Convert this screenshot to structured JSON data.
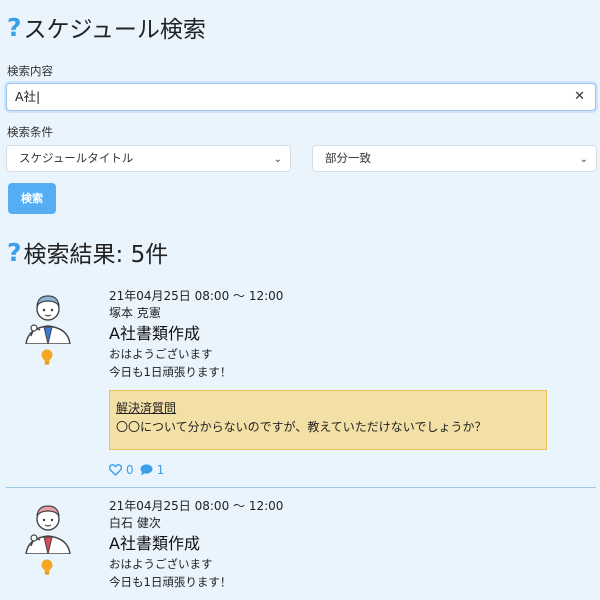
{
  "search_heading": "スケジュール検索",
  "form": {
    "content_label": "検索内容",
    "query_value": "A社|",
    "condition_label": "検索条件",
    "field_select": "スケジュールタイトル",
    "match_select": "部分一致",
    "search_button": "検索"
  },
  "results": {
    "heading": "検索結果: 5件",
    "items": [
      {
        "datetime": "21年04月25日 08:00 ～ 12:00",
        "author": "塚本 克憲",
        "title": "A社書類作成",
        "line1": "おはようございます",
        "line2": "今日も1日頑張ります！",
        "question_label": "解決済質問",
        "question_text": "〇〇について分からないのですが、教えていただけないでしょうか？",
        "likes": "0",
        "comments": "1",
        "tie_color": "#3a7bd5"
      },
      {
        "datetime": "21年04月25日 08:00 ～ 12:00",
        "author": "白石 健次",
        "title": "A社書類作成",
        "line1": "おはようございます",
        "line2": "今日も1日頑張ります！",
        "tie_color": "#d94a5a"
      }
    ]
  },
  "icons": {
    "heading": "question-mark-icon",
    "clear": "close-icon",
    "bulb": "lightbulb-icon",
    "like": "heart-icon",
    "comment": "speech-bubble-icon"
  },
  "colors": {
    "accent": "#55aef4",
    "bulb": "#f5a623",
    "question_bg": "#f3e0a6"
  }
}
